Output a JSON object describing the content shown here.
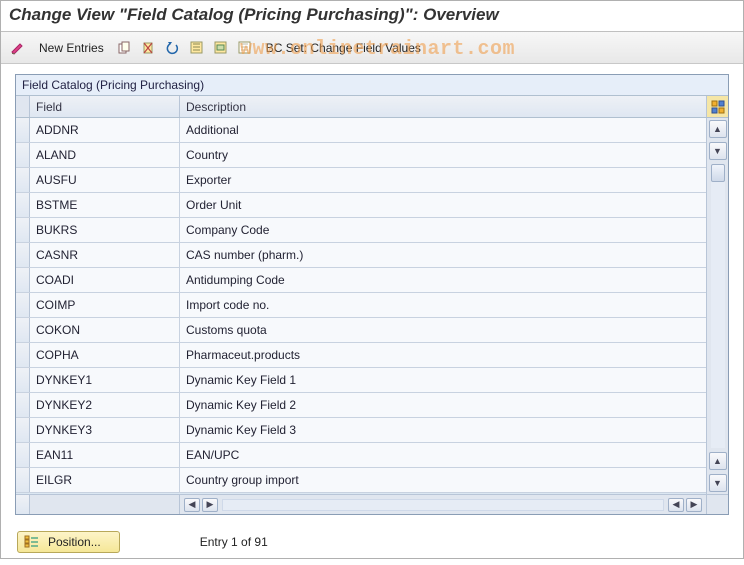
{
  "title": "Change View \"Field Catalog (Pricing Purchasing)\": Overview",
  "toolbar": {
    "new_entries": "New Entries",
    "bc_set": "BC Set: Change Field Values"
  },
  "watermark": "www.onlinetrainart.com",
  "table": {
    "title": "Field Catalog (Pricing Purchasing)",
    "columns": {
      "field": "Field",
      "description": "Description"
    },
    "rows": [
      {
        "field": "ADDNR",
        "description": "Additional"
      },
      {
        "field": "ALAND",
        "description": "Country"
      },
      {
        "field": "AUSFU",
        "description": "Exporter"
      },
      {
        "field": "BSTME",
        "description": "Order Unit"
      },
      {
        "field": "BUKRS",
        "description": "Company Code"
      },
      {
        "field": "CASNR",
        "description": "CAS number (pharm.)"
      },
      {
        "field": "COADI",
        "description": "Antidumping Code"
      },
      {
        "field": "COIMP",
        "description": "Import code no."
      },
      {
        "field": "COKON",
        "description": "Customs quota"
      },
      {
        "field": "COPHA",
        "description": "Pharmaceut.products"
      },
      {
        "field": "DYNKEY1",
        "description": "Dynamic Key Field 1"
      },
      {
        "field": "DYNKEY2",
        "description": "Dynamic Key Field 2"
      },
      {
        "field": "DYNKEY3",
        "description": "Dynamic Key Field 3"
      },
      {
        "field": "EAN11",
        "description": "EAN/UPC"
      },
      {
        "field": "EILGR",
        "description": "Country group import"
      }
    ]
  },
  "footer": {
    "position_label": "Position...",
    "entry_text": "Entry 1 of 91"
  }
}
